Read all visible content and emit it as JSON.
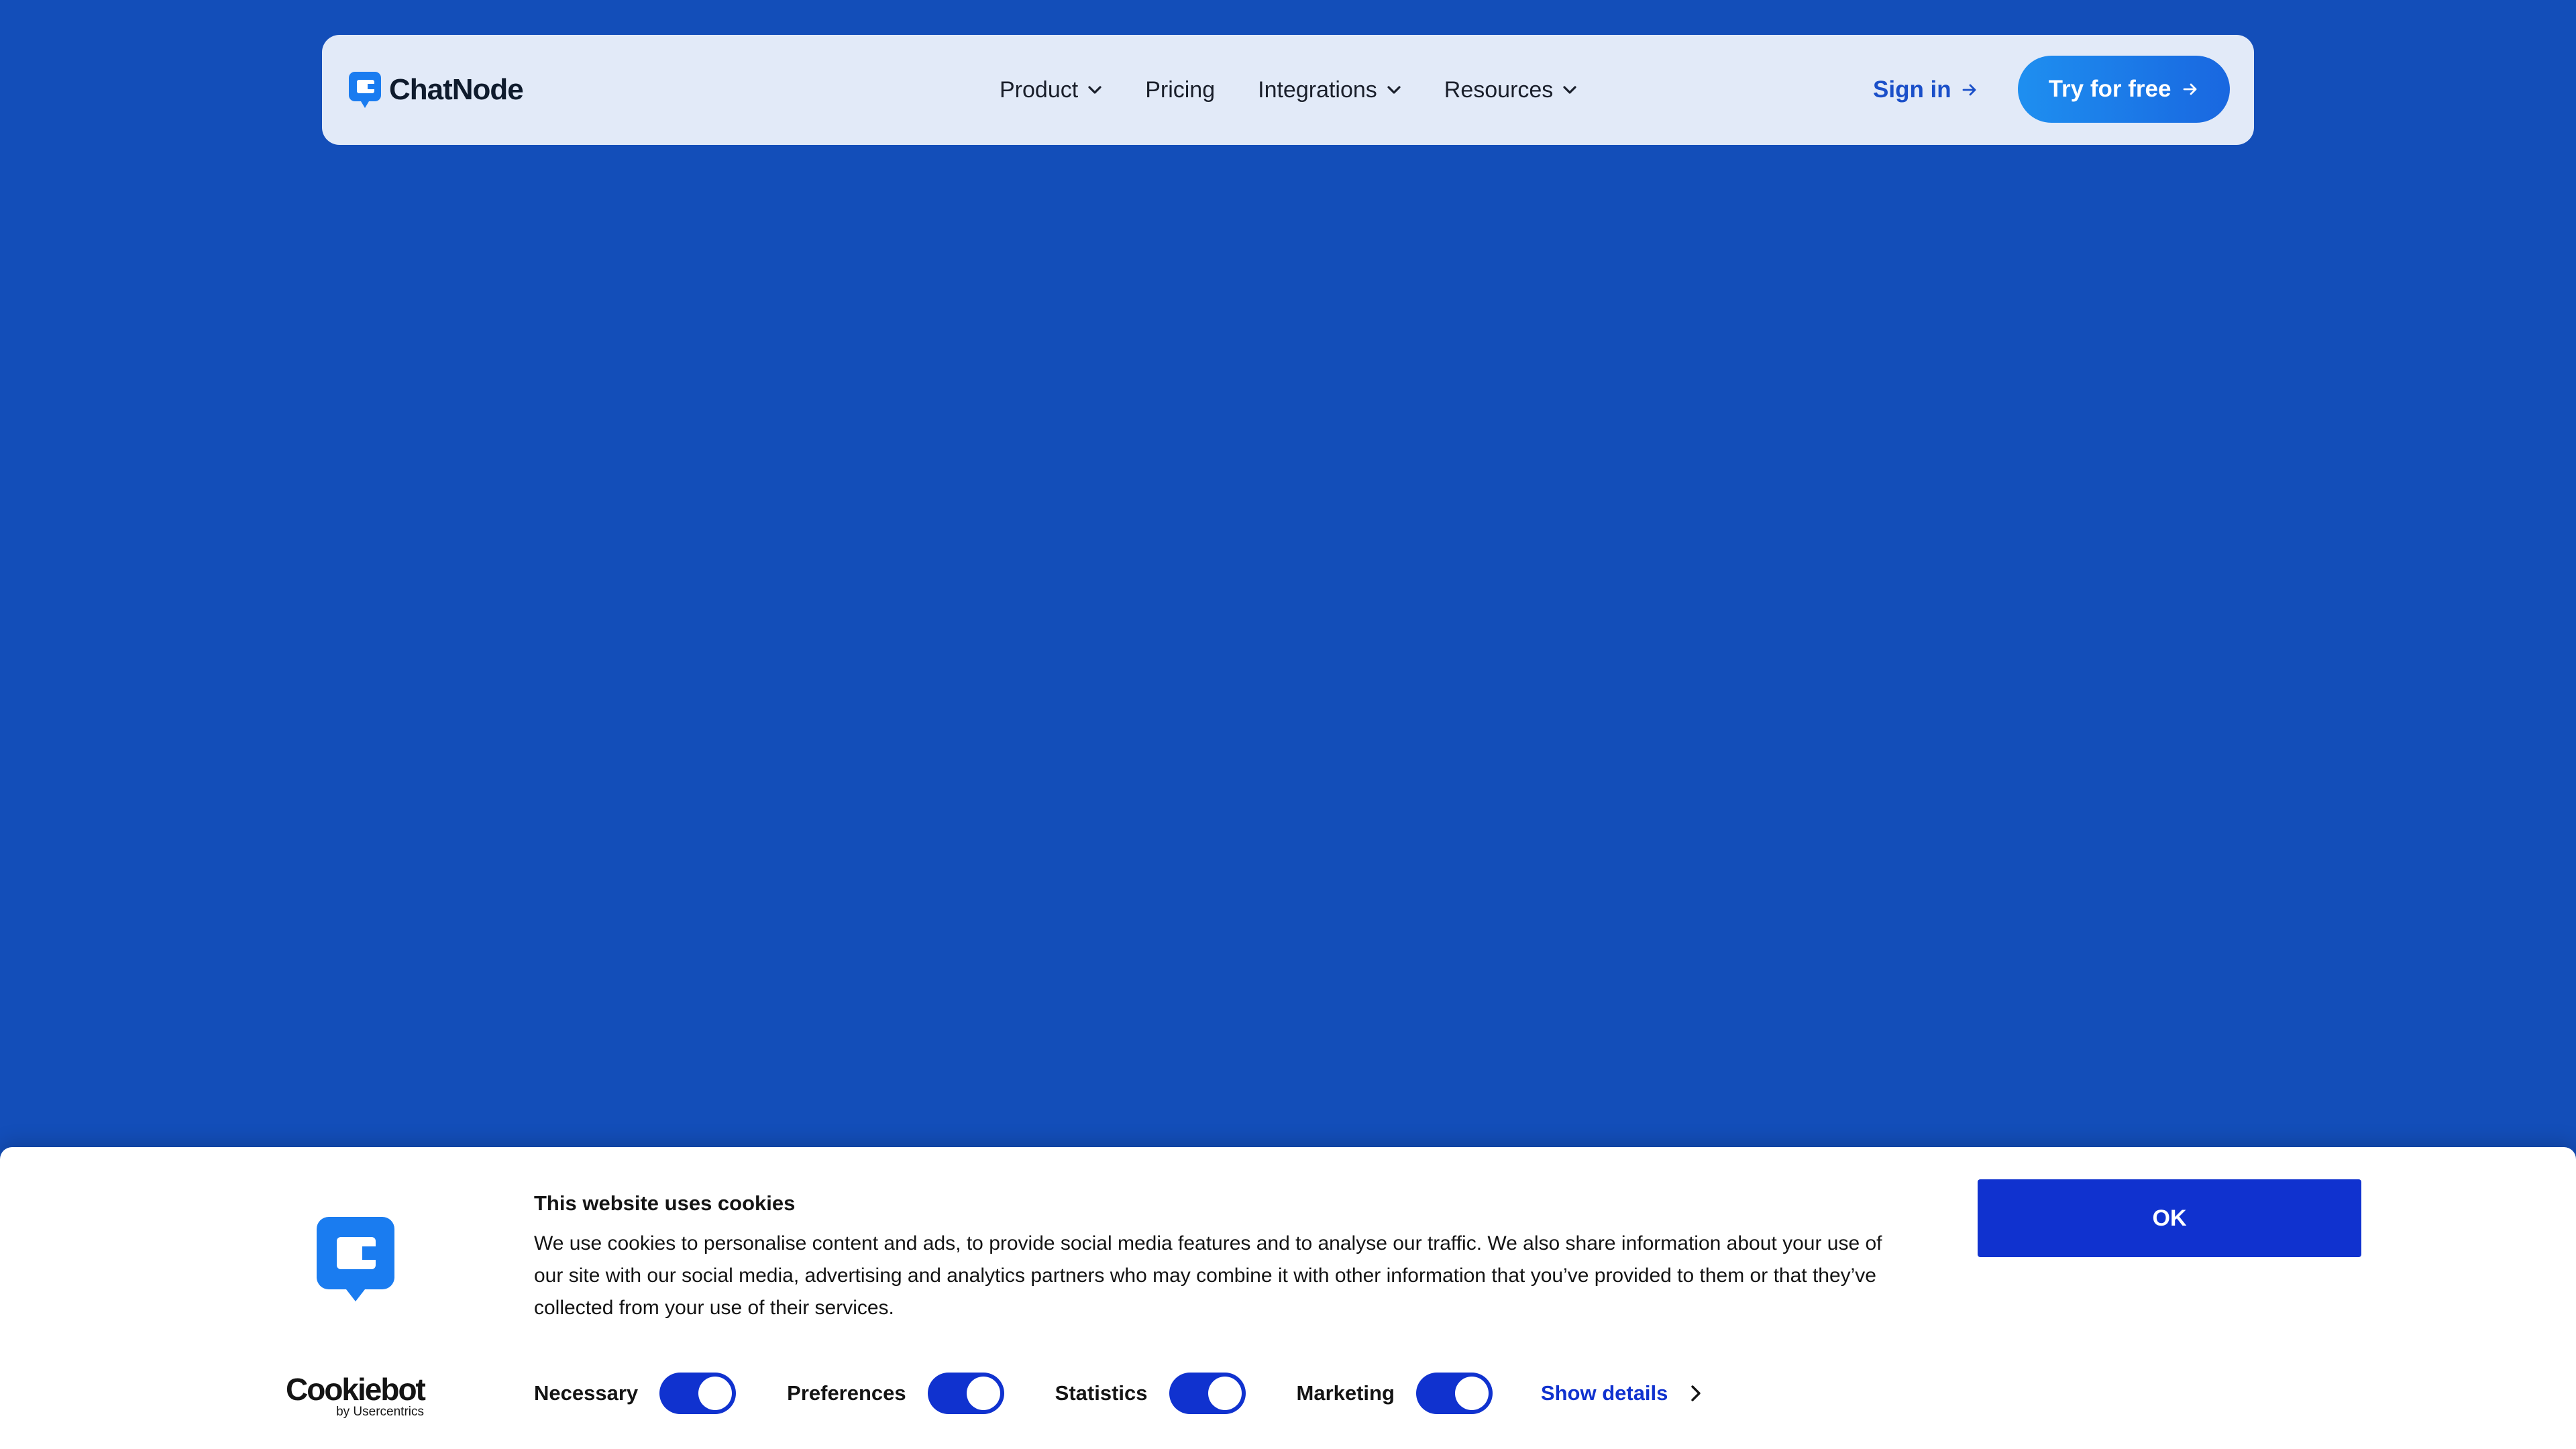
{
  "colors": {
    "page_background": "#134eb9",
    "nav_background": "#e2eaf8",
    "brand_blue": "#1e8ff0",
    "cookie_accent": "#1032cf"
  },
  "nav": {
    "logo_icon": "chatnode-logo-icon",
    "brand": "ChatNode",
    "links": [
      {
        "label": "Product",
        "icon": "chevron-down-icon"
      },
      {
        "label": "Pricing"
      },
      {
        "label": "Integrations",
        "icon": "chevron-down-icon"
      },
      {
        "label": "Resources",
        "icon": "chevron-down-icon"
      }
    ],
    "sign_in": "Sign in",
    "try_free": "Try for free"
  },
  "cookie_banner": {
    "title": "This website uses cookies",
    "body": "We use cookies to personalise content and ads, to provide social media features and to analyse our traffic. We also share information about your use of our site with our social media, advertising and analytics partners who may combine it with other information that you’ve provided to them or that they’ve collected from your use of their services.",
    "provider": "Cookiebot",
    "provider_sub": "by Usercentrics",
    "toggles": [
      {
        "label": "Necessary",
        "checked": true
      },
      {
        "label": "Preferences",
        "checked": true
      },
      {
        "label": "Statistics",
        "checked": true
      },
      {
        "label": "Marketing",
        "checked": true
      }
    ],
    "show_details": "Show details",
    "ok": "OK"
  }
}
